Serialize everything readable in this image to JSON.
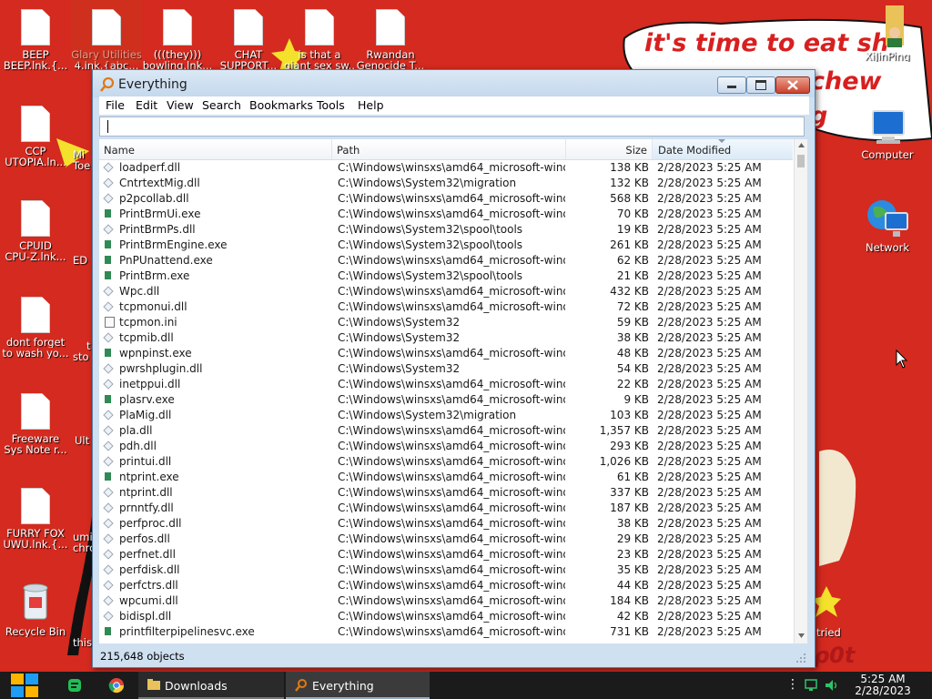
{
  "desktop": {
    "speech_text": "it's time to eat sh",
    "speech_text2": "chew",
    "speech_text3": "g",
    "stray_text": "tried",
    "stray_text2": "ρ0t",
    "icons_left": [
      {
        "label": "BEEP",
        "label2": "BEEP.lnk.{...",
        "icon": "document-icon"
      },
      {
        "label": "CCP",
        "label2": "UTOPIA.ln...",
        "icon": "document-icon"
      },
      {
        "label": "CPUID",
        "label2": "CPU-Z.lnk...",
        "icon": "document-icon"
      },
      {
        "label": "dont forget",
        "label2": "to wash yo...",
        "icon": "document-icon"
      },
      {
        "label": "Freeware",
        "label2": "Sys Note r...",
        "icon": "document-icon"
      },
      {
        "label": "FURRY FOX",
        "label2": "UWU.lnk.{...",
        "icon": "document-icon"
      },
      {
        "label": "Recycle Bin",
        "label2": "",
        "icon": "recycle-bin-icon"
      }
    ],
    "icons_col2": [
      {
        "label": "Mi",
        "label2": "Toe"
      },
      {
        "label": "ED",
        "label2": ""
      },
      {
        "label": "t",
        "label2": "sto"
      },
      {
        "label": "Ult",
        "label2": ""
      },
      {
        "label": "umi",
        "label2": "chro"
      },
      {
        "label": "this",
        "label2": ""
      }
    ],
    "icons_top": [
      {
        "label": "Glary Utilities",
        "label2": "4.lnk.{abc..."
      },
      {
        "label": "(((they)))",
        "label2": "bowling.lnk..."
      },
      {
        "label": "CHAT",
        "label2": "SUPPORT..."
      },
      {
        "label": "is that a",
        "label2": "giant sex sw..."
      },
      {
        "label": "Rwandan",
        "label2": "Genocide T..."
      }
    ],
    "icons_right": [
      {
        "label": "XiJinPing",
        "icon": "folder-user-icon"
      },
      {
        "label": "Computer",
        "icon": "computer-icon"
      },
      {
        "label": "Network",
        "icon": "network-icon"
      }
    ]
  },
  "window": {
    "title": "Everything",
    "menu": [
      "File",
      "Edit",
      "View",
      "Search",
      "Bookmarks",
      "Tools",
      "Help"
    ],
    "search_value": "",
    "columns": {
      "name": "Name",
      "path": "Path",
      "size": "Size",
      "date": "Date Modified"
    },
    "status": "215,648 objects",
    "rows": [
      {
        "name": "loadperf.dll",
        "path": "C:\\Windows\\winsxs\\amd64_microsoft-wind...",
        "size": "138 KB",
        "date": "2/28/2023 5:25 AM",
        "type": "dll"
      },
      {
        "name": "CntrtextMig.dll",
        "path": "C:\\Windows\\System32\\migration",
        "size": "132 KB",
        "date": "2/28/2023 5:25 AM",
        "type": "dll"
      },
      {
        "name": "p2pcollab.dll",
        "path": "C:\\Windows\\winsxs\\amd64_microsoft-wind...",
        "size": "568 KB",
        "date": "2/28/2023 5:25 AM",
        "type": "dll"
      },
      {
        "name": "PrintBrmUi.exe",
        "path": "C:\\Windows\\winsxs\\amd64_microsoft-wind...",
        "size": "70 KB",
        "date": "2/28/2023 5:25 AM",
        "type": "exe"
      },
      {
        "name": "PrintBrmPs.dll",
        "path": "C:\\Windows\\System32\\spool\\tools",
        "size": "19 KB",
        "date": "2/28/2023 5:25 AM",
        "type": "dll"
      },
      {
        "name": "PrintBrmEngine.exe",
        "path": "C:\\Windows\\System32\\spool\\tools",
        "size": "261 KB",
        "date": "2/28/2023 5:25 AM",
        "type": "exe"
      },
      {
        "name": "PnPUnattend.exe",
        "path": "C:\\Windows\\winsxs\\amd64_microsoft-wind...",
        "size": "62 KB",
        "date": "2/28/2023 5:25 AM",
        "type": "exe"
      },
      {
        "name": "PrintBrm.exe",
        "path": "C:\\Windows\\System32\\spool\\tools",
        "size": "21 KB",
        "date": "2/28/2023 5:25 AM",
        "type": "exe"
      },
      {
        "name": "Wpc.dll",
        "path": "C:\\Windows\\winsxs\\amd64_microsoft-wind...",
        "size": "432 KB",
        "date": "2/28/2023 5:25 AM",
        "type": "dll"
      },
      {
        "name": "tcpmonui.dll",
        "path": "C:\\Windows\\winsxs\\amd64_microsoft-wind...",
        "size": "72 KB",
        "date": "2/28/2023 5:25 AM",
        "type": "dll"
      },
      {
        "name": "tcpmon.ini",
        "path": "C:\\Windows\\System32",
        "size": "59 KB",
        "date": "2/28/2023 5:25 AM",
        "type": "ini"
      },
      {
        "name": "tcpmib.dll",
        "path": "C:\\Windows\\System32",
        "size": "38 KB",
        "date": "2/28/2023 5:25 AM",
        "type": "dll"
      },
      {
        "name": "wpnpinst.exe",
        "path": "C:\\Windows\\winsxs\\amd64_microsoft-wind...",
        "size": "48 KB",
        "date": "2/28/2023 5:25 AM",
        "type": "exe"
      },
      {
        "name": "pwrshplugin.dll",
        "path": "C:\\Windows\\System32",
        "size": "54 KB",
        "date": "2/28/2023 5:25 AM",
        "type": "dll"
      },
      {
        "name": "inetppui.dll",
        "path": "C:\\Windows\\winsxs\\amd64_microsoft-wind...",
        "size": "22 KB",
        "date": "2/28/2023 5:25 AM",
        "type": "dll"
      },
      {
        "name": "plasrv.exe",
        "path": "C:\\Windows\\winsxs\\amd64_microsoft-wind...",
        "size": "9 KB",
        "date": "2/28/2023 5:25 AM",
        "type": "exe"
      },
      {
        "name": "PlaMig.dll",
        "path": "C:\\Windows\\System32\\migration",
        "size": "103 KB",
        "date": "2/28/2023 5:25 AM",
        "type": "dll"
      },
      {
        "name": "pla.dll",
        "path": "C:\\Windows\\winsxs\\amd64_microsoft-wind...",
        "size": "1,357 KB",
        "date": "2/28/2023 5:25 AM",
        "type": "dll"
      },
      {
        "name": "pdh.dll",
        "path": "C:\\Windows\\winsxs\\amd64_microsoft-wind...",
        "size": "293 KB",
        "date": "2/28/2023 5:25 AM",
        "type": "dll"
      },
      {
        "name": "printui.dll",
        "path": "C:\\Windows\\winsxs\\amd64_microsoft-wind...",
        "size": "1,026 KB",
        "date": "2/28/2023 5:25 AM",
        "type": "dll"
      },
      {
        "name": "ntprint.exe",
        "path": "C:\\Windows\\winsxs\\amd64_microsoft-wind...",
        "size": "61 KB",
        "date": "2/28/2023 5:25 AM",
        "type": "exe"
      },
      {
        "name": "ntprint.dll",
        "path": "C:\\Windows\\winsxs\\amd64_microsoft-wind...",
        "size": "337 KB",
        "date": "2/28/2023 5:25 AM",
        "type": "dll"
      },
      {
        "name": "prnntfy.dll",
        "path": "C:\\Windows\\winsxs\\amd64_microsoft-wind...",
        "size": "187 KB",
        "date": "2/28/2023 5:25 AM",
        "type": "dll"
      },
      {
        "name": "perfproc.dll",
        "path": "C:\\Windows\\winsxs\\amd64_microsoft-wind...",
        "size": "38 KB",
        "date": "2/28/2023 5:25 AM",
        "type": "dll"
      },
      {
        "name": "perfos.dll",
        "path": "C:\\Windows\\winsxs\\amd64_microsoft-wind...",
        "size": "29 KB",
        "date": "2/28/2023 5:25 AM",
        "type": "dll"
      },
      {
        "name": "perfnet.dll",
        "path": "C:\\Windows\\winsxs\\amd64_microsoft-wind...",
        "size": "23 KB",
        "date": "2/28/2023 5:25 AM",
        "type": "dll"
      },
      {
        "name": "perfdisk.dll",
        "path": "C:\\Windows\\winsxs\\amd64_microsoft-wind...",
        "size": "35 KB",
        "date": "2/28/2023 5:25 AM",
        "type": "dll"
      },
      {
        "name": "perfctrs.dll",
        "path": "C:\\Windows\\winsxs\\amd64_microsoft-wind...",
        "size": "44 KB",
        "date": "2/28/2023 5:25 AM",
        "type": "dll"
      },
      {
        "name": "wpcumi.dll",
        "path": "C:\\Windows\\winsxs\\amd64_microsoft-wind...",
        "size": "184 KB",
        "date": "2/28/2023 5:25 AM",
        "type": "dll"
      },
      {
        "name": "bidispl.dll",
        "path": "C:\\Windows\\winsxs\\amd64_microsoft-wind...",
        "size": "42 KB",
        "date": "2/28/2023 5:25 AM",
        "type": "dll"
      },
      {
        "name": "printfilterpipelinesvc.exe",
        "path": "C:\\Windows\\winsxs\\amd64_microsoft-wind...",
        "size": "731 KB",
        "date": "2/28/2023 5:25 AM",
        "type": "exe"
      }
    ]
  },
  "taskbar": {
    "downloads_label": "Downloads",
    "everything_label": "Everything",
    "time": "5:25 AM",
    "date": "2/28/2023"
  },
  "colors": {
    "desktop_bg": "#d42a1f",
    "taskbar_bg": "#1b1b1b",
    "window_frame": "#cfe0f1"
  }
}
